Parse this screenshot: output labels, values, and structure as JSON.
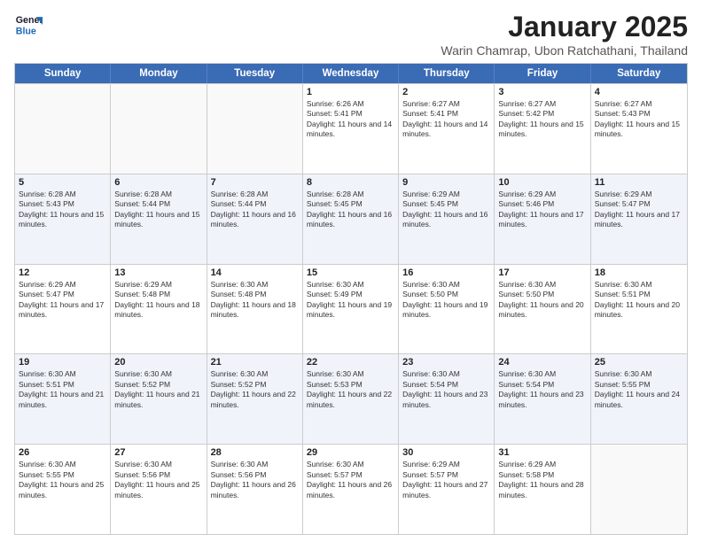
{
  "logo": {
    "line1": "General",
    "line2": "Blue"
  },
  "title": "January 2025",
  "location": "Warin Chamrap, Ubon Ratchathani, Thailand",
  "weekdays": [
    "Sunday",
    "Monday",
    "Tuesday",
    "Wednesday",
    "Thursday",
    "Friday",
    "Saturday"
  ],
  "rows": [
    [
      {
        "day": "",
        "sunrise": "",
        "sunset": "",
        "daylight": "",
        "empty": true
      },
      {
        "day": "",
        "sunrise": "",
        "sunset": "",
        "daylight": "",
        "empty": true
      },
      {
        "day": "",
        "sunrise": "",
        "sunset": "",
        "daylight": "",
        "empty": true
      },
      {
        "day": "1",
        "sunrise": "Sunrise: 6:26 AM",
        "sunset": "Sunset: 5:41 PM",
        "daylight": "Daylight: 11 hours and 14 minutes."
      },
      {
        "day": "2",
        "sunrise": "Sunrise: 6:27 AM",
        "sunset": "Sunset: 5:41 PM",
        "daylight": "Daylight: 11 hours and 14 minutes."
      },
      {
        "day": "3",
        "sunrise": "Sunrise: 6:27 AM",
        "sunset": "Sunset: 5:42 PM",
        "daylight": "Daylight: 11 hours and 15 minutes."
      },
      {
        "day": "4",
        "sunrise": "Sunrise: 6:27 AM",
        "sunset": "Sunset: 5:43 PM",
        "daylight": "Daylight: 11 hours and 15 minutes."
      }
    ],
    [
      {
        "day": "5",
        "sunrise": "Sunrise: 6:28 AM",
        "sunset": "Sunset: 5:43 PM",
        "daylight": "Daylight: 11 hours and 15 minutes."
      },
      {
        "day": "6",
        "sunrise": "Sunrise: 6:28 AM",
        "sunset": "Sunset: 5:44 PM",
        "daylight": "Daylight: 11 hours and 15 minutes."
      },
      {
        "day": "7",
        "sunrise": "Sunrise: 6:28 AM",
        "sunset": "Sunset: 5:44 PM",
        "daylight": "Daylight: 11 hours and 16 minutes."
      },
      {
        "day": "8",
        "sunrise": "Sunrise: 6:28 AM",
        "sunset": "Sunset: 5:45 PM",
        "daylight": "Daylight: 11 hours and 16 minutes."
      },
      {
        "day": "9",
        "sunrise": "Sunrise: 6:29 AM",
        "sunset": "Sunset: 5:45 PM",
        "daylight": "Daylight: 11 hours and 16 minutes."
      },
      {
        "day": "10",
        "sunrise": "Sunrise: 6:29 AM",
        "sunset": "Sunset: 5:46 PM",
        "daylight": "Daylight: 11 hours and 17 minutes."
      },
      {
        "day": "11",
        "sunrise": "Sunrise: 6:29 AM",
        "sunset": "Sunset: 5:47 PM",
        "daylight": "Daylight: 11 hours and 17 minutes."
      }
    ],
    [
      {
        "day": "12",
        "sunrise": "Sunrise: 6:29 AM",
        "sunset": "Sunset: 5:47 PM",
        "daylight": "Daylight: 11 hours and 17 minutes."
      },
      {
        "day": "13",
        "sunrise": "Sunrise: 6:29 AM",
        "sunset": "Sunset: 5:48 PM",
        "daylight": "Daylight: 11 hours and 18 minutes."
      },
      {
        "day": "14",
        "sunrise": "Sunrise: 6:30 AM",
        "sunset": "Sunset: 5:48 PM",
        "daylight": "Daylight: 11 hours and 18 minutes."
      },
      {
        "day": "15",
        "sunrise": "Sunrise: 6:30 AM",
        "sunset": "Sunset: 5:49 PM",
        "daylight": "Daylight: 11 hours and 19 minutes."
      },
      {
        "day": "16",
        "sunrise": "Sunrise: 6:30 AM",
        "sunset": "Sunset: 5:50 PM",
        "daylight": "Daylight: 11 hours and 19 minutes."
      },
      {
        "day": "17",
        "sunrise": "Sunrise: 6:30 AM",
        "sunset": "Sunset: 5:50 PM",
        "daylight": "Daylight: 11 hours and 20 minutes."
      },
      {
        "day": "18",
        "sunrise": "Sunrise: 6:30 AM",
        "sunset": "Sunset: 5:51 PM",
        "daylight": "Daylight: 11 hours and 20 minutes."
      }
    ],
    [
      {
        "day": "19",
        "sunrise": "Sunrise: 6:30 AM",
        "sunset": "Sunset: 5:51 PM",
        "daylight": "Daylight: 11 hours and 21 minutes."
      },
      {
        "day": "20",
        "sunrise": "Sunrise: 6:30 AM",
        "sunset": "Sunset: 5:52 PM",
        "daylight": "Daylight: 11 hours and 21 minutes."
      },
      {
        "day": "21",
        "sunrise": "Sunrise: 6:30 AM",
        "sunset": "Sunset: 5:52 PM",
        "daylight": "Daylight: 11 hours and 22 minutes."
      },
      {
        "day": "22",
        "sunrise": "Sunrise: 6:30 AM",
        "sunset": "Sunset: 5:53 PM",
        "daylight": "Daylight: 11 hours and 22 minutes."
      },
      {
        "day": "23",
        "sunrise": "Sunrise: 6:30 AM",
        "sunset": "Sunset: 5:54 PM",
        "daylight": "Daylight: 11 hours and 23 minutes."
      },
      {
        "day": "24",
        "sunrise": "Sunrise: 6:30 AM",
        "sunset": "Sunset: 5:54 PM",
        "daylight": "Daylight: 11 hours and 23 minutes."
      },
      {
        "day": "25",
        "sunrise": "Sunrise: 6:30 AM",
        "sunset": "Sunset: 5:55 PM",
        "daylight": "Daylight: 11 hours and 24 minutes."
      }
    ],
    [
      {
        "day": "26",
        "sunrise": "Sunrise: 6:30 AM",
        "sunset": "Sunset: 5:55 PM",
        "daylight": "Daylight: 11 hours and 25 minutes."
      },
      {
        "day": "27",
        "sunrise": "Sunrise: 6:30 AM",
        "sunset": "Sunset: 5:56 PM",
        "daylight": "Daylight: 11 hours and 25 minutes."
      },
      {
        "day": "28",
        "sunrise": "Sunrise: 6:30 AM",
        "sunset": "Sunset: 5:56 PM",
        "daylight": "Daylight: 11 hours and 26 minutes."
      },
      {
        "day": "29",
        "sunrise": "Sunrise: 6:30 AM",
        "sunset": "Sunset: 5:57 PM",
        "daylight": "Daylight: 11 hours and 26 minutes."
      },
      {
        "day": "30",
        "sunrise": "Sunrise: 6:29 AM",
        "sunset": "Sunset: 5:57 PM",
        "daylight": "Daylight: 11 hours and 27 minutes."
      },
      {
        "day": "31",
        "sunrise": "Sunrise: 6:29 AM",
        "sunset": "Sunset: 5:58 PM",
        "daylight": "Daylight: 11 hours and 28 minutes."
      },
      {
        "day": "",
        "sunrise": "",
        "sunset": "",
        "daylight": "",
        "empty": true
      }
    ]
  ]
}
